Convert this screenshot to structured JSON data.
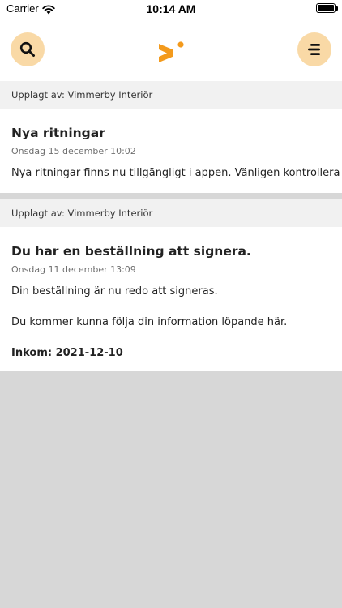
{
  "status_bar": {
    "carrier": "Carrier",
    "time": "10:14 AM"
  },
  "header": {
    "search_icon": "search-icon",
    "menu_icon": "menu-icon",
    "logo": "app-logo"
  },
  "colors": {
    "accent": "#f39a1c",
    "button_bg": "#f9d9a6"
  },
  "posts": [
    {
      "posted_by": "Upplagt av: Vimmerby Interiör",
      "title": "Nya ritningar",
      "date": "Onsdag 15 december 10:02",
      "body": "Nya ritningar finns nu tillgängligt i appen. Vänligen kontrollera"
    },
    {
      "posted_by": "Upplagt av: Vimmerby Interiör",
      "title": "Du har en beställning att signera.",
      "date": "Onsdag 11 december 13:09",
      "body": "Din beställning är nu redo att signeras.",
      "body2": "Du kommer kunna följa din information löpande här.",
      "received": "Inkom: 2021-12-10"
    }
  ]
}
